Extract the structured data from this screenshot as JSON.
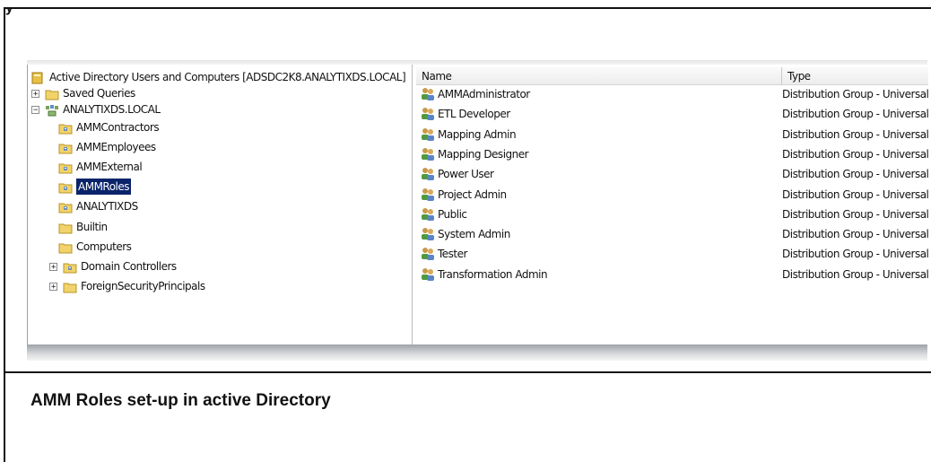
{
  "top_fragment": "y",
  "tree": {
    "root_label": "Active Directory Users and Computers [ADSDC2K8.ANALYTIXDS.LOCAL]",
    "items": [
      {
        "label": "Saved Queries",
        "expander": "+",
        "icon": "folder-icon"
      },
      {
        "label": "ANALYTIXDS.LOCAL",
        "expander": "−",
        "icon": "domain-icon"
      },
      {
        "label": "AMMContractors",
        "icon": "ou-folder-icon"
      },
      {
        "label": "AMMEmployees",
        "icon": "ou-folder-icon"
      },
      {
        "label": "AMMExternal",
        "icon": "ou-folder-icon"
      },
      {
        "label": "AMMRoles",
        "icon": "ou-folder-icon",
        "selected": true
      },
      {
        "label": "ANALYTIXDS",
        "icon": "ou-folder-icon"
      },
      {
        "label": "Builtin",
        "icon": "folder-icon"
      },
      {
        "label": "Computers",
        "icon": "folder-icon"
      },
      {
        "label": "Domain Controllers",
        "expander": "+",
        "icon": "ou-folder-icon"
      },
      {
        "label": "ForeignSecurityPrincipals",
        "expander": "+",
        "icon": "folder-icon"
      }
    ]
  },
  "list": {
    "columns": [
      "Name",
      "Type"
    ],
    "rows": [
      {
        "name": "AMMAdministrator",
        "type": "Distribution Group - Universal"
      },
      {
        "name": "ETL Developer",
        "type": "Distribution Group - Universal"
      },
      {
        "name": "Mapping Admin",
        "type": "Distribution Group - Universal"
      },
      {
        "name": "Mapping Designer",
        "type": "Distribution Group - Universal"
      },
      {
        "name": "Power User",
        "type": "Distribution Group - Universal"
      },
      {
        "name": "Project Admin",
        "type": "Distribution Group - Universal"
      },
      {
        "name": "Public",
        "type": "Distribution Group - Universal"
      },
      {
        "name": "System Admin",
        "type": "Distribution Group - Universal"
      },
      {
        "name": "Tester",
        "type": "Distribution Group - Universal"
      },
      {
        "name": "Transformation Admin",
        "type": "Distribution Group - Universal"
      }
    ]
  },
  "caption": "AMM Roles set-up in active Directory",
  "colors": {
    "selection": "#0a246a",
    "folder": "#f2d36b"
  }
}
